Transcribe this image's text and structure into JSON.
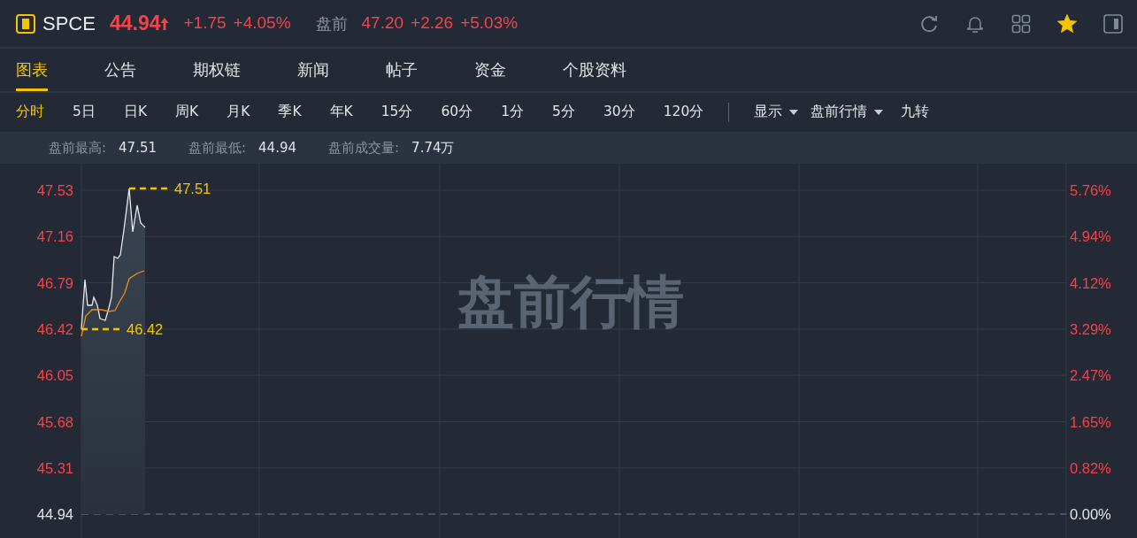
{
  "quote": {
    "symbol": "SPCE",
    "price": "44.94",
    "change": "+1.75",
    "change_pct": "+4.05%",
    "session_label": "盘前",
    "session_price": "47.20",
    "session_change": "+2.26",
    "session_change_pct": "+5.03%",
    "favorited": true
  },
  "tabs": [
    {
      "label": "图表",
      "selected": true
    },
    {
      "label": "公告",
      "selected": false
    },
    {
      "label": "期权链",
      "selected": false
    },
    {
      "label": "新闻",
      "selected": false
    },
    {
      "label": "帖子",
      "selected": false
    },
    {
      "label": "资金",
      "selected": false
    },
    {
      "label": "个股资料",
      "selected": false
    }
  ],
  "periods": [
    {
      "label": "分时",
      "selected": true
    },
    {
      "label": "5日",
      "selected": false
    },
    {
      "label": "日K",
      "selected": false
    },
    {
      "label": "周K",
      "selected": false
    },
    {
      "label": "月K",
      "selected": false
    },
    {
      "label": "季K",
      "selected": false
    },
    {
      "label": "年K",
      "selected": false
    },
    {
      "label": "15分",
      "selected": false
    },
    {
      "label": "60分",
      "selected": false
    },
    {
      "label": "1分",
      "selected": false
    },
    {
      "label": "5分",
      "selected": false
    },
    {
      "label": "30分",
      "selected": false
    },
    {
      "label": "120分",
      "selected": false
    }
  ],
  "chart_options": [
    {
      "kind": "dropdown",
      "label": "显示"
    },
    {
      "kind": "dropdown",
      "label": "盘前行情"
    },
    {
      "kind": "button",
      "label": "九转"
    }
  ],
  "stats": [
    {
      "label": "盘前最高:",
      "value": "47.51"
    },
    {
      "label": "盘前最低:",
      "value": "44.94"
    },
    {
      "label": "盘前成交量:",
      "value": "7.74万"
    }
  ],
  "chart": {
    "mode_label": "盘前行情",
    "price_axis": [
      "47.53",
      "47.16",
      "46.79",
      "46.42",
      "46.05",
      "45.68",
      "45.31",
      "44.94"
    ],
    "percent_axis": [
      "5.76%",
      "4.94%",
      "4.12%",
      "3.29%",
      "2.47%",
      "1.65%",
      "0.82%",
      "0.00%"
    ],
    "high_marker": "47.51",
    "low_marker": "46.42"
  }
}
